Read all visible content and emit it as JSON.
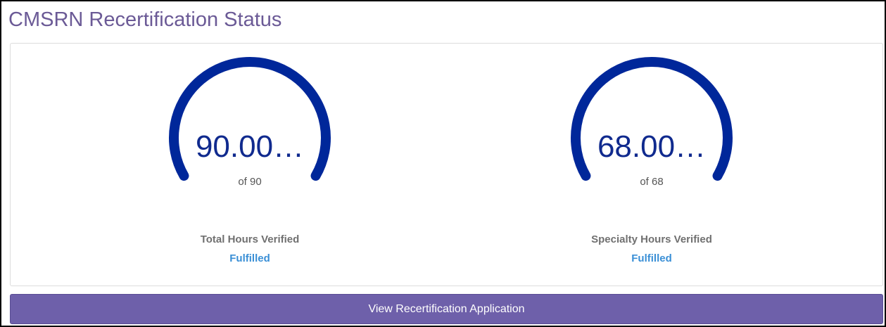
{
  "page": {
    "title": "CMSRN Recertification Status"
  },
  "gauges": [
    {
      "value_text": "90.00…",
      "of_text": "of 90",
      "label": "Total Hours Verified",
      "status": "Fulfilled",
      "progress": 1.0
    },
    {
      "value_text": "68.00…",
      "of_text": "of 68",
      "label": "Specialty Hours Verified",
      "status": "Fulfilled",
      "progress": 1.0
    }
  ],
  "actions": {
    "view_application_label": "View Recertification Application"
  },
  "colors": {
    "title": "#6b5a96",
    "gauge_arc": "#00279a",
    "gauge_value": "#102a8e",
    "status_fulfilled": "#3a8fd6",
    "button_bg": "#6e60aa",
    "button_text": "#ffffff"
  }
}
